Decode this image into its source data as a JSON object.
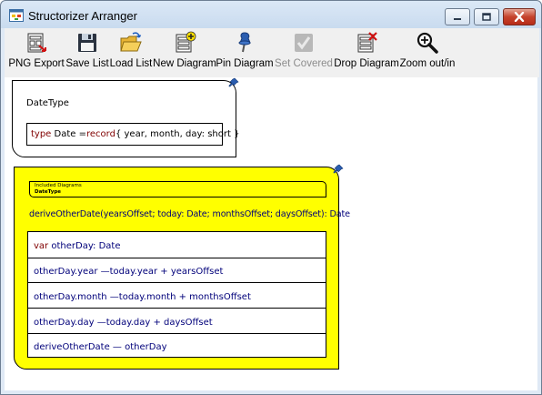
{
  "window": {
    "title": "Structorizer Arranger"
  },
  "toolbar": {
    "items": [
      {
        "label": "PNG Export",
        "icon": "png-export-icon",
        "enabled": true
      },
      {
        "label": "Save List",
        "icon": "floppy-disk-icon",
        "enabled": true
      },
      {
        "label": "Load List",
        "icon": "open-folder-icon",
        "enabled": true
      },
      {
        "label": "New Diagram",
        "icon": "new-diagram-icon",
        "enabled": true
      },
      {
        "label": "Pin Diagram",
        "icon": "pushpin-icon",
        "enabled": true
      },
      {
        "label": "Set Covered",
        "icon": "checkmark-icon",
        "enabled": false
      },
      {
        "label": "Drop Diagram",
        "icon": "drop-diagram-icon",
        "enabled": true
      },
      {
        "label": "Zoom out/in",
        "icon": "magnifier-icon",
        "enabled": true
      }
    ]
  },
  "diagrams": {
    "datetype": {
      "name": "DateType",
      "content": {
        "keyword": "type",
        "text1": "Date =",
        "keyword2": "record",
        "text2": "{ year, month, day: short }"
      }
    },
    "derive": {
      "included_label": "Included Diagrams",
      "included_item": "DateType",
      "header": "deriveOtherDate(yearsOffset; today: Date; monthsOffset; daysOffset): Date",
      "rows": [
        {
          "kw": "var",
          "text": "otherDay: Date"
        },
        {
          "text": "otherDay.year  —today.year + yearsOffset"
        },
        {
          "text": "otherDay.month  —today.month + monthsOffset"
        },
        {
          "text": "otherDay.day  —today.day + daysOffset"
        },
        {
          "text": "deriveOtherDate  — otherDay"
        }
      ],
      "highlight_color": "#ffff00"
    }
  },
  "colors": {
    "keyword": "#800000",
    "function": "#00007a",
    "selected_diagram": "#ffff00"
  }
}
